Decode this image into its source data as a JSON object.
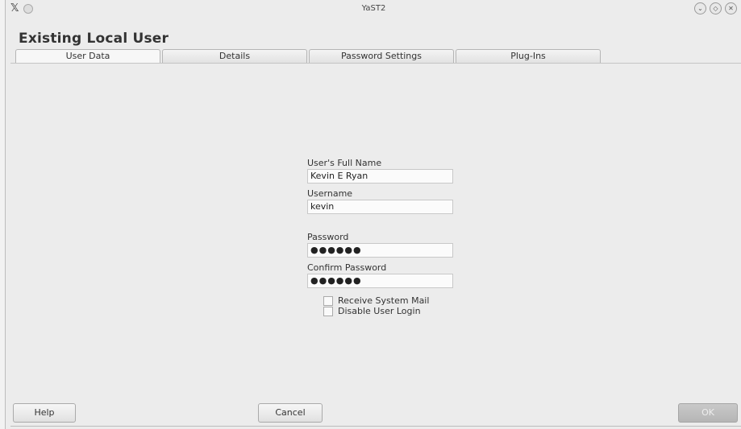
{
  "window": {
    "title": "YaST2",
    "controls": [
      "minimize-icon",
      "maximize-icon",
      "close-icon"
    ]
  },
  "header": {
    "title": "Existing Local User"
  },
  "tabs": [
    {
      "label": "User Data",
      "active": true
    },
    {
      "label": "Details",
      "active": false
    },
    {
      "label": "Password Settings",
      "active": false
    },
    {
      "label": "Plug-Ins",
      "active": false
    }
  ],
  "form": {
    "full_name_label": "User's Full Name",
    "full_name_value": "Kevin E Ryan",
    "username_label": "Username",
    "username_value": "kevin",
    "password_label": "Password",
    "password_value": "●●●●●●",
    "confirm_label": "Confirm Password",
    "confirm_value": "●●●●●●",
    "receive_mail_label": "Receive System Mail",
    "receive_mail_checked": false,
    "disable_login_label": "Disable User Login",
    "disable_login_checked": false
  },
  "buttons": {
    "help": "Help",
    "cancel": "Cancel",
    "ok": "OK"
  }
}
